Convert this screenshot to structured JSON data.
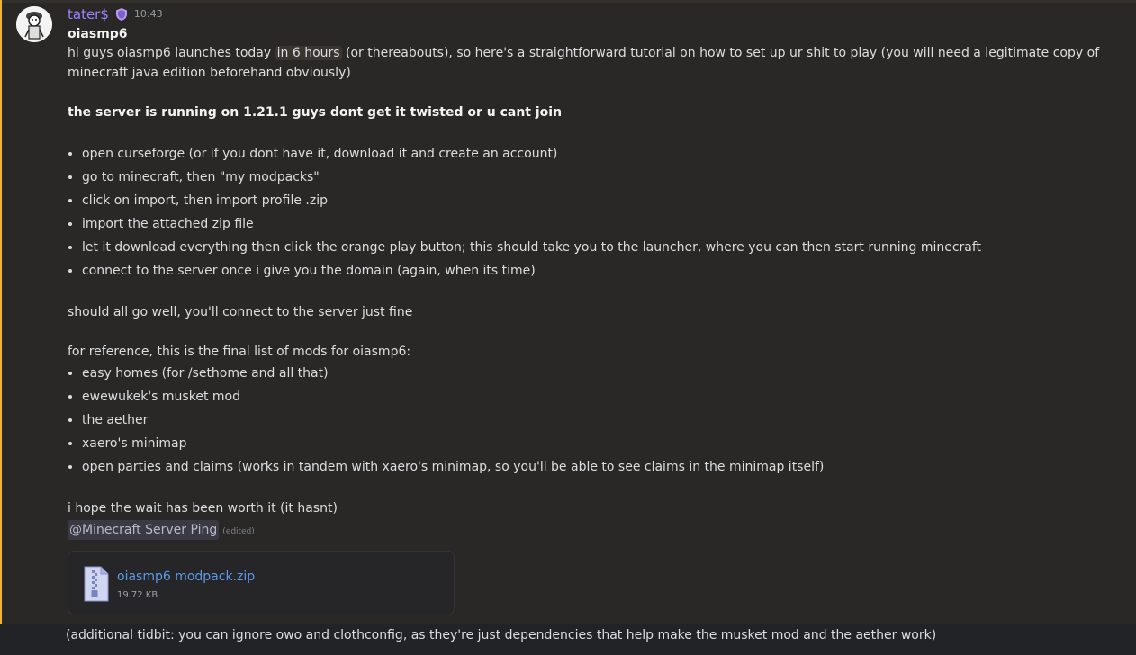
{
  "message": {
    "author": "tater$",
    "timestamp": "10:43",
    "title": "oiasmp6",
    "intro_before": "hi guys oiasmp6 launches today",
    "intro_highlight": "in 6 hours",
    "intro_after": "(or thereabouts), so here's a straightforward tutorial on how to set up ur shit to play (you will need a legitimate copy of minecraft java edition beforehand obviously)",
    "bold_line": "the server is running on 1.21.1 guys dont get it twisted or u cant join",
    "steps": [
      "open curseforge (or if you dont have it, download it and create an account)",
      "go to minecraft, then \"my modpacks\"",
      "click on import, then import profile .zip",
      "import the attached zip file",
      "let it download everything then click the orange play button; this should take you to the launcher, where you can then start running minecraft",
      "connect to the server once i give you the domain (again, when its time)"
    ],
    "should_go_well": "should all go well, you'll connect to the server just fine",
    "mods_heading": "for reference, this is the final list of mods for oiasmp6:",
    "mods": [
      "easy homes (for /sethome and all that)",
      "ewewukek's musket mod",
      "the aether",
      "xaero's minimap",
      "open parties and claims (works in tandem with xaero's minimap, so you'll be able to see claims in the minimap itself)"
    ],
    "closing": "i hope the wait has been worth it (it hasnt)",
    "ping": "@Minecraft Server Ping",
    "edited": "(edited)"
  },
  "attachment": {
    "file_name": "oiasmp6 modpack.zip",
    "file_size": "19.72 KB"
  },
  "followup": {
    "text": "(additional tidbit: you can ignore owo and clothconfig, as they're just dependencies that help make the musket mod and the aether work)"
  },
  "colors": {
    "username": "#9b84ff",
    "highlight_bar": "#f0b232",
    "link": "#5c9ae6"
  }
}
